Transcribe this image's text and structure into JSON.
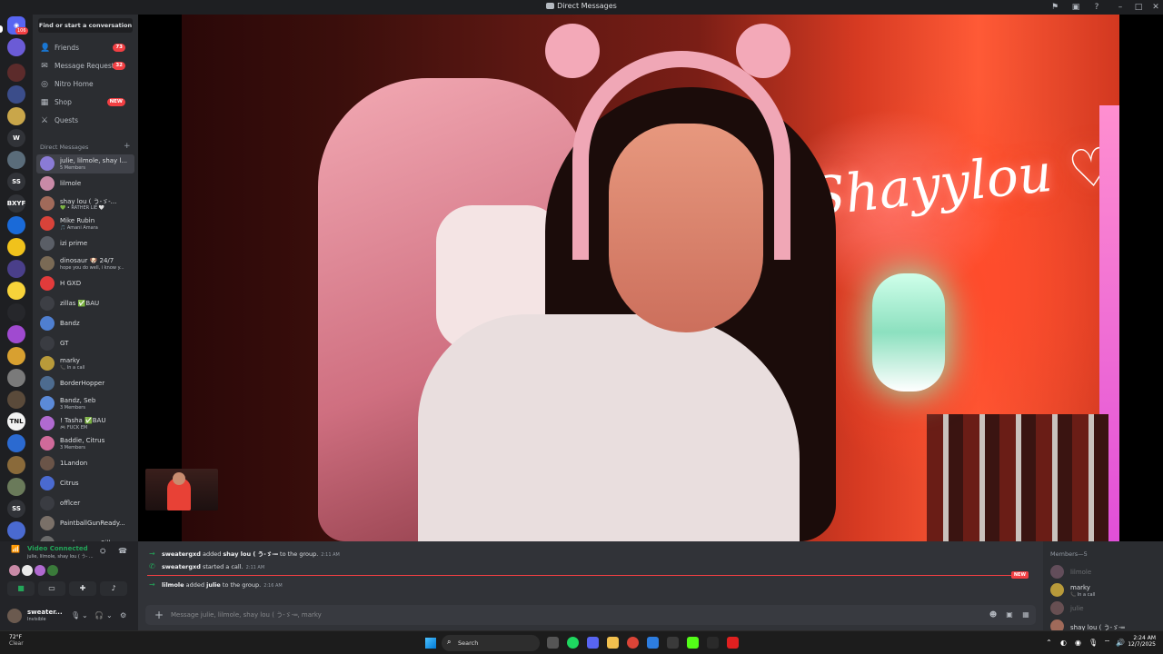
{
  "window": {
    "title": "Direct Messages"
  },
  "rail": {
    "home_badge": "106",
    "text_servers": [
      "W",
      "SS",
      "BXYF",
      "TNL",
      "SS"
    ]
  },
  "sidebar": {
    "find_label": "Find or start a conversation",
    "nav": [
      {
        "label": "Friends",
        "badge": "73",
        "icon": "friends-icon"
      },
      {
        "label": "Message Requests",
        "badge": "32",
        "icon": "message-requests-icon"
      },
      {
        "label": "Nitro Home",
        "badge": "",
        "icon": "nitro-icon"
      },
      {
        "label": "Shop",
        "badge": "NEW",
        "icon": "shop-icon"
      },
      {
        "label": "Quests",
        "badge": "",
        "icon": "quests-icon"
      }
    ],
    "dm_header": "Direct Messages",
    "dms": [
      {
        "name": "julie, lilmole, sһaу l...",
        "sub": "5 Members",
        "color": "#8a7bd6"
      },
      {
        "name": "lilmole",
        "sub": "",
        "color": "#c98aa7"
      },
      {
        "name": "sһaу lou ( う-ゞ-...",
        "sub": "💚 • RATHER LIE 🤍",
        "color": "#a06a5a"
      },
      {
        "name": "Mike Rubin",
        "sub": "🎵 Amani Amara",
        "color": "#d8433a"
      },
      {
        "name": "izi prime",
        "sub": "",
        "color": "#5a5e66"
      },
      {
        "name": "dinosaur 🐶 24/7",
        "sub": "hope you do well, i know y...",
        "color": "#7a6a55"
      },
      {
        "name": "H GXD",
        "sub": "",
        "color": "#e23b3b"
      },
      {
        "name": "zillas ✅BAU",
        "sub": "",
        "color": "#3d3f45"
      },
      {
        "name": "Bandz",
        "sub": "",
        "color": "#4f7fd0"
      },
      {
        "name": "GT",
        "sub": "",
        "color": "#3a3c42"
      },
      {
        "name": "marky",
        "sub": "📞 In a call",
        "color": "#b89a3a"
      },
      {
        "name": "BorderHopper",
        "sub": "",
        "color": "#4d6b8f"
      },
      {
        "name": "Bandz, Seb",
        "sub": "3 Members",
        "color": "#5b8ad8"
      },
      {
        "name": "! Tasha ✅BAU",
        "sub": "🎮 FUCK EM",
        "color": "#b06ad0"
      },
      {
        "name": "Baddie, Citrus",
        "sub": "3 Members",
        "color": "#d06a9a"
      },
      {
        "name": "1Landon",
        "sub": "",
        "color": "#6a5448"
      },
      {
        "name": "Citrus",
        "sub": "",
        "color": "#4a6ad0"
      },
      {
        "name": "offlcer",
        "sub": "",
        "color": "#3a3c42"
      },
      {
        "name": "PaintballGunReady...",
        "sub": "",
        "color": "#7a7068"
      },
      {
        "name": "marky_gxrz, Silky...",
        "sub": "",
        "color": "#6a6a6a"
      }
    ]
  },
  "voice": {
    "title": "Video Connected",
    "subtitle": "julie, lilmole, sһaу lou ( う- ...",
    "buttons": [
      "camera-icon",
      "screen-share-icon",
      "activity-icon",
      "soundboard-icon"
    ]
  },
  "user": {
    "name": "sweater...",
    "status": "Invisible"
  },
  "chat": {
    "messages": [
      {
        "actor": "sweatergxd",
        "text": "added",
        "target": "sһaу lou ( う-ゞ-═",
        "tail": "to the group.",
        "time": "2:11 AM"
      },
      {
        "actor": "sweatergxd",
        "text": "started a call.",
        "target": "",
        "tail": "",
        "time": "2:11 AM"
      },
      {
        "actor": "lilmole",
        "text": "added",
        "target": "julie",
        "tail": "to the group.",
        "time": "2:16 AM"
      }
    ],
    "new_label": "NEW",
    "placeholder": "Message julie, lilmole, sһaу lou ( う-ゞ-═, marky"
  },
  "members": {
    "header": "Members—5",
    "list": [
      {
        "name": "lilmole",
        "sub": "",
        "dim": true,
        "color": "#c98aa7"
      },
      {
        "name": "marky",
        "sub": "📞 In a call",
        "dim": false,
        "color": "#b89a3a"
      },
      {
        "name": "julie",
        "sub": "",
        "dim": true,
        "color": "#d68f8f"
      },
      {
        "name": "sһaу lou ( う-ゞ-═",
        "sub": "",
        "dim": false,
        "color": "#a06a5a"
      }
    ]
  },
  "taskbar": {
    "weather_temp": "72°F",
    "weather_cond": "Clear",
    "search_label": "Search",
    "time": "2:24 AM",
    "date": "12/7/2025"
  }
}
